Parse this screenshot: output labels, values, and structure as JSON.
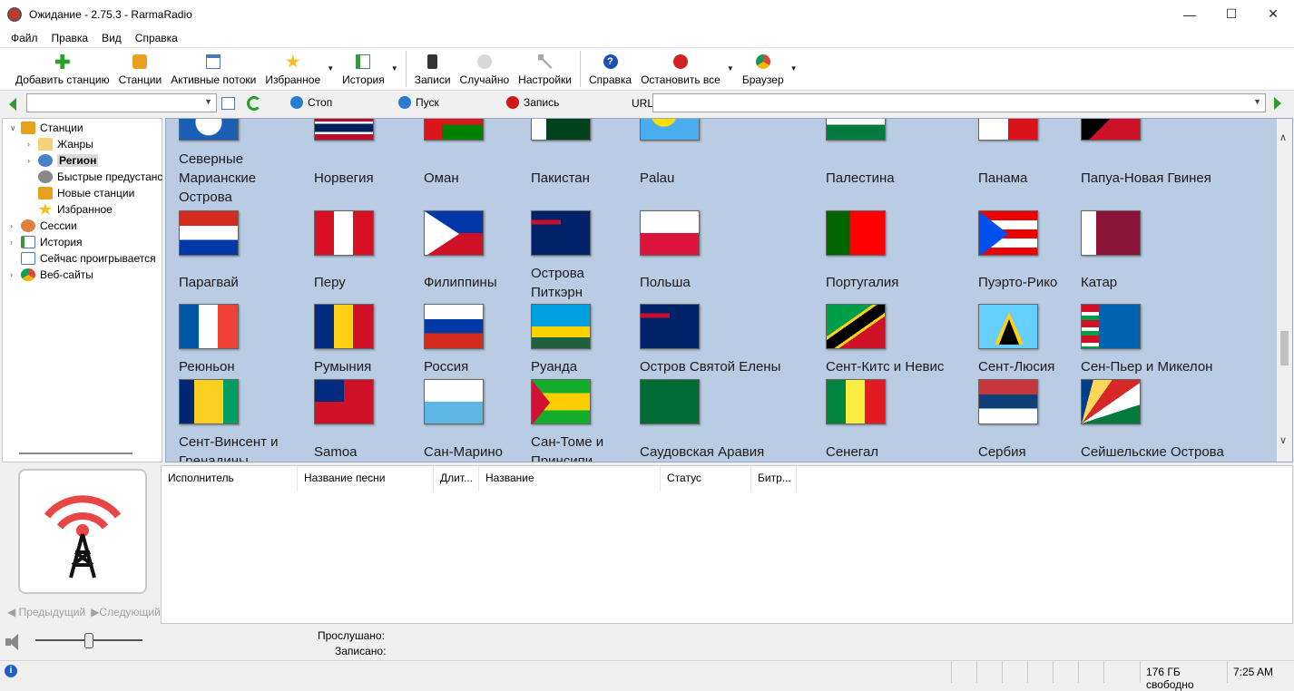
{
  "window": {
    "title": "Ожидание - 2.75.3 - RarmaRadio"
  },
  "menu": [
    "Файл",
    "Правка",
    "Вид",
    "Справка"
  ],
  "toolbar": {
    "add_station": "Добавить станцию",
    "stations": "Станции",
    "active_streams": "Активные потоки",
    "favorites": "Избранное",
    "history": "История",
    "recordings": "Записи",
    "random": "Случайно",
    "settings": "Настройки",
    "help": "Справка",
    "stop_all": "Остановить все",
    "browser": "Браузер"
  },
  "playbar": {
    "stop": "Стоп",
    "play": "Пуск",
    "record": "Запись",
    "url_label": "URL"
  },
  "tree": {
    "stations": "Станции",
    "genres": "Жанры",
    "region": "Регион",
    "presets": "Быстрые предустанс",
    "new_stations": "Новые станции",
    "favorites": "Избранное",
    "sessions": "Сессии",
    "history": "История",
    "now_playing": "Сейчас проигрывается",
    "websites": "Веб-сайты"
  },
  "countries": {
    "r0": [
      "Северные Марианские Острова",
      "Норвегия",
      "Оман",
      "Пакистан",
      "Palau",
      "Палестина",
      "Панама",
      "Папуа-Новая Гвинея"
    ],
    "r1": [
      "Парагвай",
      "Перу",
      "Филиппины",
      "Острова Питкэрн",
      "Польша",
      "Португалия",
      "Пуэрто-Рико",
      "Катар"
    ],
    "r2": [
      "Реюньон",
      "Румыния",
      "Россия",
      "Руанда",
      "Остров Святой Елены",
      "Сент-Китс и Невис",
      "Сент-Люсия",
      "Сен-Пьер и Микелон"
    ],
    "r3": [
      "Сент-Винсент и Гренадины",
      "Samoa",
      "Сан-Марино",
      "Сан-Томе и Принсипи",
      "Саудовская Аравия",
      "Сенегал",
      "Сербия",
      "Сейшельские Острова"
    ]
  },
  "nav": {
    "prev": "Предыдущий",
    "next": "Следующий"
  },
  "columns": [
    "Исполнитель",
    "Название песни",
    "Длит...",
    "Название",
    "Статус",
    "Битр..."
  ],
  "info": {
    "listened": "Прослушано:",
    "recorded": "Записано:"
  },
  "status": {
    "free_space": "176 ГБ свободно",
    "time": "7:25 AM"
  }
}
